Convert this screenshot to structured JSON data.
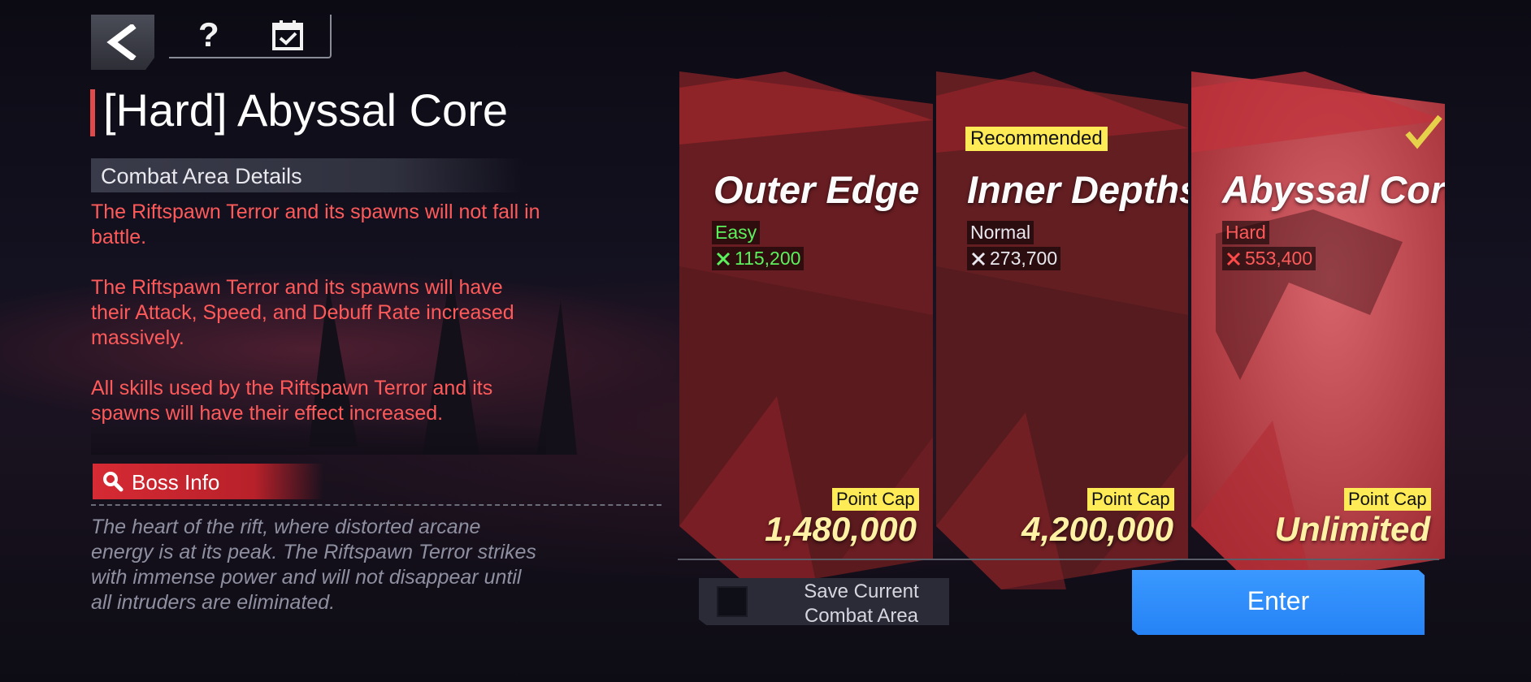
{
  "nav": {
    "back": "back-arrow-icon",
    "help": "?",
    "calendar": "calendar-check-icon"
  },
  "title": "[Hard] Abyssal Core",
  "details": {
    "header": "Combat Area Details",
    "paragraphs": [
      "The Riftspawn Terror and its spawns will not fall in battle.",
      "The Riftspawn Terror and its spawns will have their Attack, Speed, and Debuff Rate increased massively.",
      "All skills used by the Riftspawn Terror and its spawns will have their effect increased."
    ]
  },
  "boss": {
    "button_label": "Boss Info",
    "description": "The heart of the rift, where distorted arcane energy is at its peak. The Riftspawn Terror strikes with immense power and will not disappear until all intruders are eliminated."
  },
  "cards": [
    {
      "name": "Outer Edge",
      "difficulty": "Easy",
      "power": "115,200",
      "cap_label": "Point Cap",
      "cap_value": "1,480,000",
      "color": "#5cf15c"
    },
    {
      "name": "Inner Depths",
      "badge": "Recommended",
      "difficulty": "Normal",
      "power": "273,700",
      "cap_label": "Point Cap",
      "cap_value": "4,200,000",
      "color": "#e8e8ee"
    },
    {
      "name": "Abyssal Core",
      "difficulty": "Hard",
      "power": "553,400",
      "cap_label": "Point Cap",
      "cap_value": "Unlimited",
      "color": "#ff4a4a",
      "selected": true
    }
  ],
  "save": {
    "label": "Save Current Combat Area",
    "checked": false
  },
  "enter_label": "Enter",
  "colors": {
    "accent_red": "#e04a4a",
    "enter_blue": "#2f8dff",
    "badge_yellow": "#ffeb55"
  }
}
